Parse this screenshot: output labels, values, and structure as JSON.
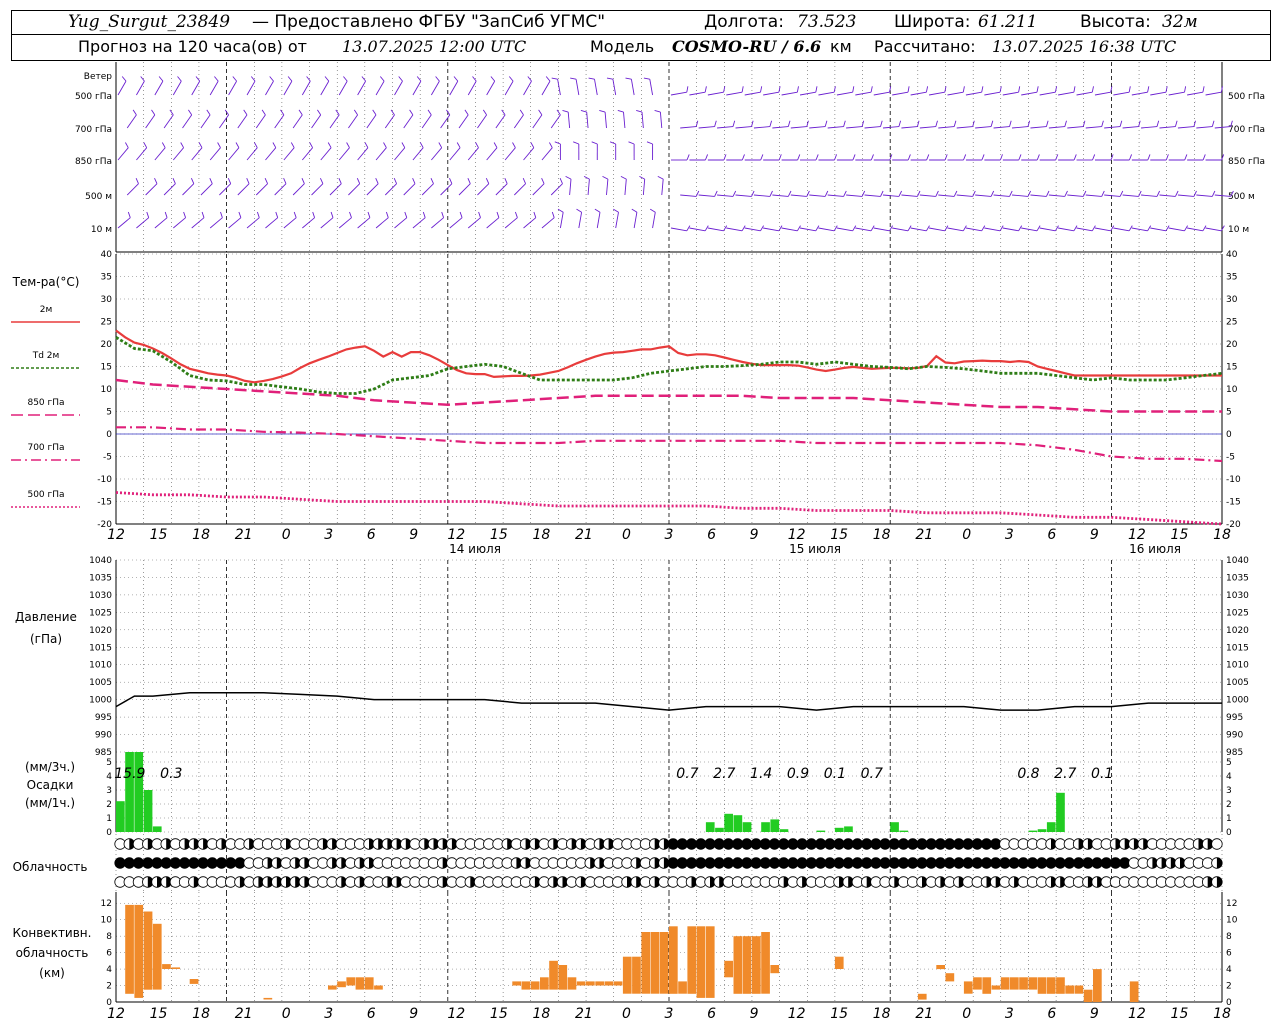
{
  "header": {
    "station": "Yug_Surgut_23849",
    "provider": "— Предоставлено ФГБУ \"ЗапСиб УГМС\"",
    "lon_label": "Долгота:",
    "lon_value": "73.523",
    "lat_label": "Широта:",
    "lat_value": "61.211",
    "alt_label": "Высота:",
    "alt_value": "32м",
    "forecast_label": "Прогноз на 120 часа(ов) от",
    "forecast_start": "13.07.2025 12:00 UTC",
    "model_label": "Модель",
    "model_name": "COSMO-RU / 6.6",
    "model_unit": "км",
    "calc_label": "Рассчитано:",
    "calc_time": "13.07.2025 16:38 UTC"
  },
  "chart_data": [
    {
      "type": "wind-barbs",
      "levels": [
        "Ветер",
        "500 гПа",
        "700 гПа",
        "850 гПа",
        "500 м",
        "10 м"
      ],
      "colors": {
        "barb": "#6a1fd0"
      }
    },
    {
      "type": "line",
      "ylabel": "Тем-ра(°C)",
      "ylim": [
        -20,
        40
      ],
      "yticks": [
        -20,
        -15,
        -10,
        -5,
        0,
        5,
        10,
        15,
        20,
        25,
        30,
        35,
        40
      ],
      "x_hours_from_start": [
        0,
        120
      ],
      "series": [
        {
          "name": "2м",
          "color": "#e83c3c",
          "style": "solid",
          "x": [
            0,
            1,
            2,
            3,
            4,
            5,
            6,
            7,
            8,
            9,
            10,
            11,
            12,
            13,
            14,
            15,
            16,
            17,
            18,
            19,
            20,
            21,
            22,
            23,
            24,
            25,
            26,
            27,
            28,
            29,
            30,
            31,
            32,
            33,
            34,
            35,
            36,
            37,
            38,
            39,
            40,
            41,
            42,
            43,
            44,
            45,
            46,
            47,
            48,
            49,
            50,
            51,
            52,
            53,
            54,
            55,
            56,
            57,
            58,
            59,
            60,
            61,
            62,
            63,
            64,
            65,
            66,
            67,
            68,
            69,
            70,
            71,
            72,
            73,
            74,
            75,
            76,
            77,
            78,
            79,
            80,
            81,
            82,
            83,
            84,
            85,
            86,
            87,
            88,
            89,
            90,
            91,
            92,
            93,
            94,
            95,
            96,
            97,
            98,
            99,
            100,
            101,
            102,
            103,
            104,
            105,
            106,
            107,
            108,
            109,
            110,
            111,
            112,
            113,
            114,
            115,
            116,
            117,
            118,
            119,
            120
          ],
          "y": [
            23,
            21.5,
            20.3,
            19.8,
            19,
            18,
            16.8,
            15.5,
            14.5,
            14,
            13.5,
            13.2,
            13,
            12.5,
            11.8,
            11.5,
            11.8,
            12.2,
            12.8,
            13.5,
            14.7,
            15.7,
            16.5,
            17.2,
            18,
            18.8,
            19.2,
            19.5,
            18.5,
            17.2,
            18.2,
            17.2,
            18.2,
            18.2,
            17.5,
            16.5,
            15.3,
            14.2,
            13.5,
            13.3,
            13.3,
            12.7,
            12.8,
            12.9,
            12.9,
            13,
            13.2,
            13.6,
            14,
            14.8,
            15.7,
            16.5,
            17.2,
            17.8,
            18.1,
            18.2,
            18.5,
            18.8,
            18.8,
            19.2,
            19.5,
            18,
            17.5,
            17.7,
            17.7,
            17.5,
            17,
            16.5,
            16,
            15.6,
            15.3,
            15.3,
            15.3,
            15.3,
            15.2,
            14.8,
            14.3,
            14,
            14.3,
            14.7,
            14.9,
            14.7,
            14.5,
            14.6,
            14.7,
            14.7,
            14.6,
            14.7,
            15.1,
            17.3,
            15.9,
            15.7,
            16.1,
            16.2,
            16.3,
            16.2,
            16.2,
            16,
            16.2,
            16,
            15,
            14.5,
            14,
            13.5,
            13,
            13,
            13,
            13,
            13,
            13,
            13,
            13,
            13,
            13,
            13,
            13,
            13,
            13,
            13,
            13,
            13
          ]
        },
        {
          "name": "Td 2м",
          "color": "#2e7d16",
          "style": "dotted",
          "x": [
            0,
            2,
            4,
            6,
            8,
            10,
            12,
            14,
            16,
            18,
            20,
            22,
            24,
            26,
            28,
            30,
            32,
            34,
            36,
            38,
            40,
            42,
            44,
            46,
            48,
            50,
            52,
            54,
            56,
            58,
            60,
            62,
            64,
            66,
            68,
            70,
            72,
            74,
            76,
            78,
            80,
            82,
            84,
            86,
            88,
            90,
            92,
            94,
            96,
            98,
            100,
            102,
            104,
            106,
            108,
            110,
            112,
            114,
            116,
            118,
            120
          ],
          "y": [
            21.5,
            19,
            18.5,
            16,
            13,
            12,
            11.8,
            11,
            11,
            10.5,
            10,
            9.3,
            9,
            9,
            10,
            12,
            12.5,
            13,
            14.5,
            15,
            15.5,
            15,
            13.5,
            12,
            12,
            12,
            12,
            12,
            12.5,
            13.5,
            14,
            14.5,
            15,
            15,
            15.2,
            15.5,
            16,
            16,
            15.5,
            16,
            15.5,
            15,
            14.8,
            14.5,
            15,
            14.8,
            14.5,
            14,
            13.5,
            13.5,
            13.5,
            13,
            12.5,
            12,
            12.5,
            12,
            12,
            12,
            12.5,
            13,
            13.5
          ]
        },
        {
          "name": "850 гПа",
          "color": "#e0207a",
          "style": "dashed",
          "x": [
            0,
            4,
            8,
            12,
            16,
            20,
            24,
            28,
            32,
            36,
            40,
            44,
            48,
            52,
            56,
            60,
            64,
            68,
            72,
            76,
            80,
            84,
            88,
            92,
            96,
            100,
            104,
            108,
            112,
            116,
            120
          ],
          "y": [
            12,
            11,
            10.5,
            10,
            9.5,
            9,
            8.5,
            7.5,
            7,
            6.5,
            7,
            7.5,
            8,
            8.5,
            8.5,
            8.5,
            8.5,
            8.5,
            8,
            8,
            8,
            7.5,
            7,
            6.5,
            6,
            6,
            5.5,
            5,
            5,
            5,
            5
          ]
        },
        {
          "name": "700 гПа",
          "color": "#e0207a",
          "style": "dashdot",
          "x": [
            0,
            4,
            8,
            12,
            16,
            20,
            24,
            28,
            32,
            36,
            40,
            44,
            48,
            52,
            56,
            60,
            64,
            68,
            72,
            76,
            80,
            84,
            88,
            92,
            96,
            100,
            104,
            108,
            112,
            116,
            120
          ],
          "y": [
            1.5,
            1.5,
            1,
            1,
            0.5,
            0.3,
            0,
            -0.5,
            -1,
            -1.5,
            -2,
            -2,
            -2,
            -1.5,
            -1.5,
            -1.5,
            -1.5,
            -1.5,
            -1.5,
            -2,
            -2,
            -2,
            -2,
            -2,
            -2,
            -2.5,
            -3.5,
            -5,
            -5.5,
            -5.5,
            -6
          ]
        },
        {
          "name": "500 гПа",
          "color": "#e0207a",
          "style": "dotted-small",
          "x": [
            0,
            4,
            8,
            12,
            16,
            20,
            24,
            28,
            32,
            36,
            40,
            44,
            48,
            52,
            56,
            60,
            64,
            68,
            72,
            76,
            80,
            84,
            88,
            92,
            96,
            100,
            104,
            108,
            112,
            116,
            120
          ],
          "y": [
            -13,
            -13.5,
            -13.5,
            -14,
            -14,
            -14.5,
            -15,
            -15,
            -15,
            -15,
            -15,
            -15.5,
            -16,
            -16,
            -16,
            -16,
            -16,
            -16.5,
            -16.5,
            -17,
            -17,
            -17,
            -17.5,
            -17.5,
            -17.5,
            -18,
            -18.5,
            -18.5,
            -19,
            -19.5,
            -20
          ]
        }
      ],
      "xticks": [
        "12",
        "15",
        "18",
        "21",
        "0",
        "3",
        "6",
        "9",
        "12",
        "15",
        "18",
        "21",
        "0",
        "3",
        "6",
        "9",
        "12",
        "15",
        "18",
        "21",
        "0",
        "3",
        "6",
        "9",
        "12",
        "15",
        "18"
      ],
      "date_labels": [
        "14 июля",
        "15 июля",
        "16 июля"
      ]
    },
    {
      "type": "line",
      "ylabel": "Давление",
      "yunit": "(гПа)",
      "ylim": [
        985,
        1040
      ],
      "yticks": [
        985,
        990,
        995,
        1000,
        1005,
        1010,
        1015,
        1020,
        1025,
        1030,
        1035,
        1040
      ],
      "series": [
        {
          "name": "",
          "color": "#000000",
          "x": [
            0,
            2,
            4,
            8,
            12,
            16,
            20,
            24,
            28,
            32,
            36,
            40,
            44,
            48,
            52,
            56,
            60,
            64,
            68,
            72,
            76,
            80,
            84,
            88,
            92,
            96,
            100,
            104,
            108,
            112,
            116,
            120
          ],
          "y": [
            998,
            1001,
            1001,
            1002,
            1002,
            1002,
            1001.5,
            1001,
            1000,
            1000,
            1000,
            1000,
            999,
            999,
            999,
            998,
            997,
            998,
            998,
            998,
            997,
            998,
            998,
            998,
            998,
            997,
            997,
            998,
            998,
            999,
            999,
            999
          ]
        }
      ]
    },
    {
      "type": "bar",
      "ylabel": "(мм/3ч.)",
      "ylabel2": "Осадки",
      "ylabel3": "(мм/1ч.)",
      "ylim": [
        0,
        5
      ],
      "yticks": [
        0,
        1,
        2,
        3,
        4,
        5
      ],
      "color": "#22cc22",
      "x": [
        0,
        1,
        2,
        3,
        4,
        5,
        6,
        64,
        65,
        66,
        67,
        68,
        69,
        70,
        71,
        72,
        73,
        74,
        75,
        76,
        77,
        78,
        79,
        80,
        81,
        82,
        83,
        84,
        85,
        86,
        87,
        99,
        100,
        101,
        102,
        103
      ],
      "values": [
        2.2,
        6,
        5.9,
        3,
        0.4,
        0,
        0,
        0.7,
        0.3,
        1.3,
        1.2,
        0.7,
        0,
        0.7,
        0.9,
        0.2,
        0,
        0,
        0,
        0.1,
        0,
        0.3,
        0.4,
        0,
        0,
        0,
        0,
        0.7,
        0.1,
        0,
        0,
        0.1,
        0.2,
        0.7,
        2.8,
        0
      ],
      "totals": [
        {
          "x": 1.5,
          "text": "15.9"
        },
        {
          "x": 6,
          "text": "0.3"
        },
        {
          "x": 62,
          "text": "0.7"
        },
        {
          "x": 66,
          "text": "2.7"
        },
        {
          "x": 70,
          "text": "1.4"
        },
        {
          "x": 74,
          "text": "0.9"
        },
        {
          "x": 78,
          "text": "0.1"
        },
        {
          "x": 82,
          "text": "0.7"
        },
        {
          "x": 99,
          "text": "0.8"
        },
        {
          "x": 103,
          "text": "2.7"
        },
        {
          "x": 107,
          "text": "0.1"
        }
      ]
    },
    {
      "type": "table",
      "ylabel": "Облачность",
      "rows": 3,
      "cols": 120
    },
    {
      "type": "bar",
      "ylabel": "Конвективн.",
      "ylabel2": "облачность",
      "ylabel3": "(км)",
      "ylim": [
        0,
        13
      ],
      "yticks": [
        0,
        2,
        4,
        6,
        8,
        10,
        12
      ],
      "color": "#f08a2a",
      "x": [
        0,
        1,
        2,
        3,
        4,
        5,
        6,
        7,
        8,
        9,
        10,
        11,
        12,
        13,
        14,
        15,
        16,
        17,
        18,
        19,
        20,
        21,
        22,
        23,
        24,
        25,
        26,
        27,
        28,
        29,
        30,
        31,
        32,
        33,
        34,
        35,
        36,
        37,
        38,
        39,
        40,
        41,
        42,
        43,
        44,
        45,
        46,
        47,
        48,
        49,
        50,
        51,
        52,
        53,
        54,
        55,
        56,
        57,
        58,
        59,
        60,
        61,
        62,
        63,
        64,
        65,
        66,
        67,
        68,
        69,
        70,
        71,
        72,
        73,
        74,
        75,
        76,
        77,
        78,
        79,
        80,
        81,
        82,
        83,
        84,
        85,
        86,
        87,
        88,
        89,
        90,
        91,
        92,
        93,
        94,
        95,
        96,
        97,
        98,
        99,
        100,
        101,
        102,
        103,
        104,
        105,
        106,
        107,
        108,
        109,
        110,
        111,
        112,
        113,
        114,
        115,
        116,
        117,
        118,
        119,
        120
      ],
      "tops": [
        0,
        11.8,
        11.8,
        11,
        9.5,
        4.6,
        4.2,
        0,
        2.8,
        0,
        0,
        0,
        0,
        0,
        0,
        0,
        0.5,
        0,
        0,
        0,
        0,
        0,
        0,
        2,
        2.5,
        3,
        3,
        3,
        2,
        0,
        0,
        0,
        0,
        0,
        0,
        0,
        0,
        0,
        0,
        0,
        0,
        0,
        0,
        2.5,
        2.5,
        2.5,
        3,
        5,
        4.5,
        3,
        2.5,
        2.5,
        2.5,
        2.5,
        2.5,
        5.5,
        5.5,
        8.5,
        8.5,
        8.5,
        9.2,
        2.5,
        9.2,
        9.2,
        9.2,
        0,
        5,
        8,
        8,
        8,
        8.5,
        4.5,
        0,
        0,
        0,
        0,
        0,
        0,
        5.5,
        0,
        0,
        0,
        0,
        0,
        0,
        0,
        0,
        1,
        0,
        4.5,
        3.5,
        0,
        2.5,
        3,
        3,
        2,
        3,
        3,
        3,
        3,
        3,
        3,
        3,
        2,
        2,
        1.5,
        4,
        0,
        0,
        0,
        2.5,
        0,
        0,
        0,
        0,
        0,
        0,
        0,
        0,
        0,
        0,
        0,
        0
      ],
      "bases": [
        0,
        1,
        0.5,
        1.5,
        1.5,
        4,
        4,
        0,
        2.2,
        0,
        0,
        0,
        0,
        0,
        0,
        0,
        0.3,
        0,
        0,
        0,
        0,
        0,
        0,
        1.5,
        1.8,
        2,
        1.5,
        1.5,
        1.5,
        0,
        0,
        0,
        0,
        0,
        0,
        0,
        0,
        0,
        0,
        0,
        0,
        0,
        0,
        2,
        1.5,
        1.5,
        1.5,
        1.5,
        1.5,
        1.5,
        2,
        2,
        2,
        2,
        2,
        1,
        1,
        1,
        1,
        1,
        1,
        1,
        1,
        0.5,
        0.5,
        0,
        3,
        1,
        1,
        1,
        1,
        3.5,
        0,
        0,
        0,
        0,
        0,
        0,
        4,
        0,
        0,
        0,
        0,
        0,
        0,
        0,
        0,
        0.3,
        0,
        4,
        2.5,
        0,
        1,
        1.5,
        1,
        1.5,
        1.5,
        1.5,
        1.5,
        1.5,
        1,
        1,
        1,
        1,
        1,
        0,
        0,
        0,
        2,
        0,
        0,
        0,
        0,
        0,
        0,
        0,
        0,
        0,
        0,
        0,
        0
      ]
    }
  ],
  "colors": {
    "temp2m": "#e83c3c",
    "dew": "#2e7d16",
    "upper": "#e0207a",
    "precip": "#22cc22",
    "conv": "#f08a2a",
    "wind": "#6a1fd0"
  }
}
